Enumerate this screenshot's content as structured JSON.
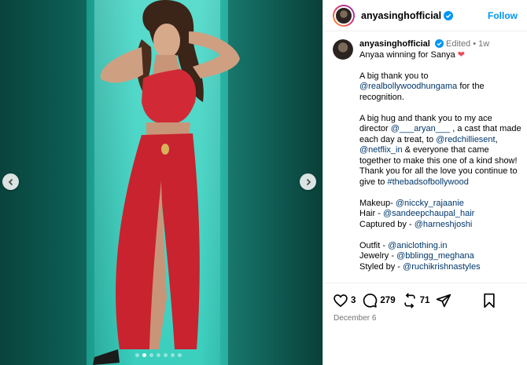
{
  "post": {
    "username": "anyasinghofficial",
    "follow_label": "Follow",
    "edited_label": "Edited",
    "time_ago": "1w",
    "caption_intro": "Anyaa winning for Sanya",
    "thanks_line_1": "A big thank you to",
    "mention_realbollywood": "@realbollywoodhungama",
    "thanks_line_2": "for the recognition.",
    "hug_line_1": "A big hug and thank you to my ace director",
    "mention_aryan": "@___aryan___",
    "hug_line_2": ", a cast that made each day a treat, to",
    "mention_redchillies": "@redchilliesent",
    "comma": ",",
    "mention_netflix": "@netflix_in",
    "hug_line_3": "& everyone that came together to make this one of a kind show! Thank you for all the love you continue to give to",
    "hashtag": "#thebadsofbollywood",
    "makeup_label": "Makeup-",
    "makeup_mention": "@niccky_rajaanie",
    "hair_label": "Hair -",
    "hair_mention": "@sandeepchaupal_hair",
    "captured_label": "Captured by -",
    "captured_mention": "@harneshjoshi",
    "outfit_label": "Outfit -",
    "outfit_mention": "@aniclothing.in",
    "jewelry_label": "Jewelry -",
    "jewelry_mention": "@bblingg_meghana",
    "styled_label": "Styled by -",
    "styled_mention": "@ruchikrishnastyles"
  },
  "actions": {
    "likes": "3",
    "comments": "279",
    "reposts": "71",
    "like_icon": "heart-icon",
    "comment_icon": "comment-icon",
    "repost_icon": "repost-icon",
    "share_icon": "share-icon",
    "save_icon": "bookmark-icon"
  },
  "date": "December 6",
  "carousel": {
    "slide_count": 7,
    "active_index": 1
  },
  "colors": {
    "link": "#00376b",
    "follow": "#0095f6",
    "verified": "#0095f6",
    "heart": "#ed4956"
  }
}
